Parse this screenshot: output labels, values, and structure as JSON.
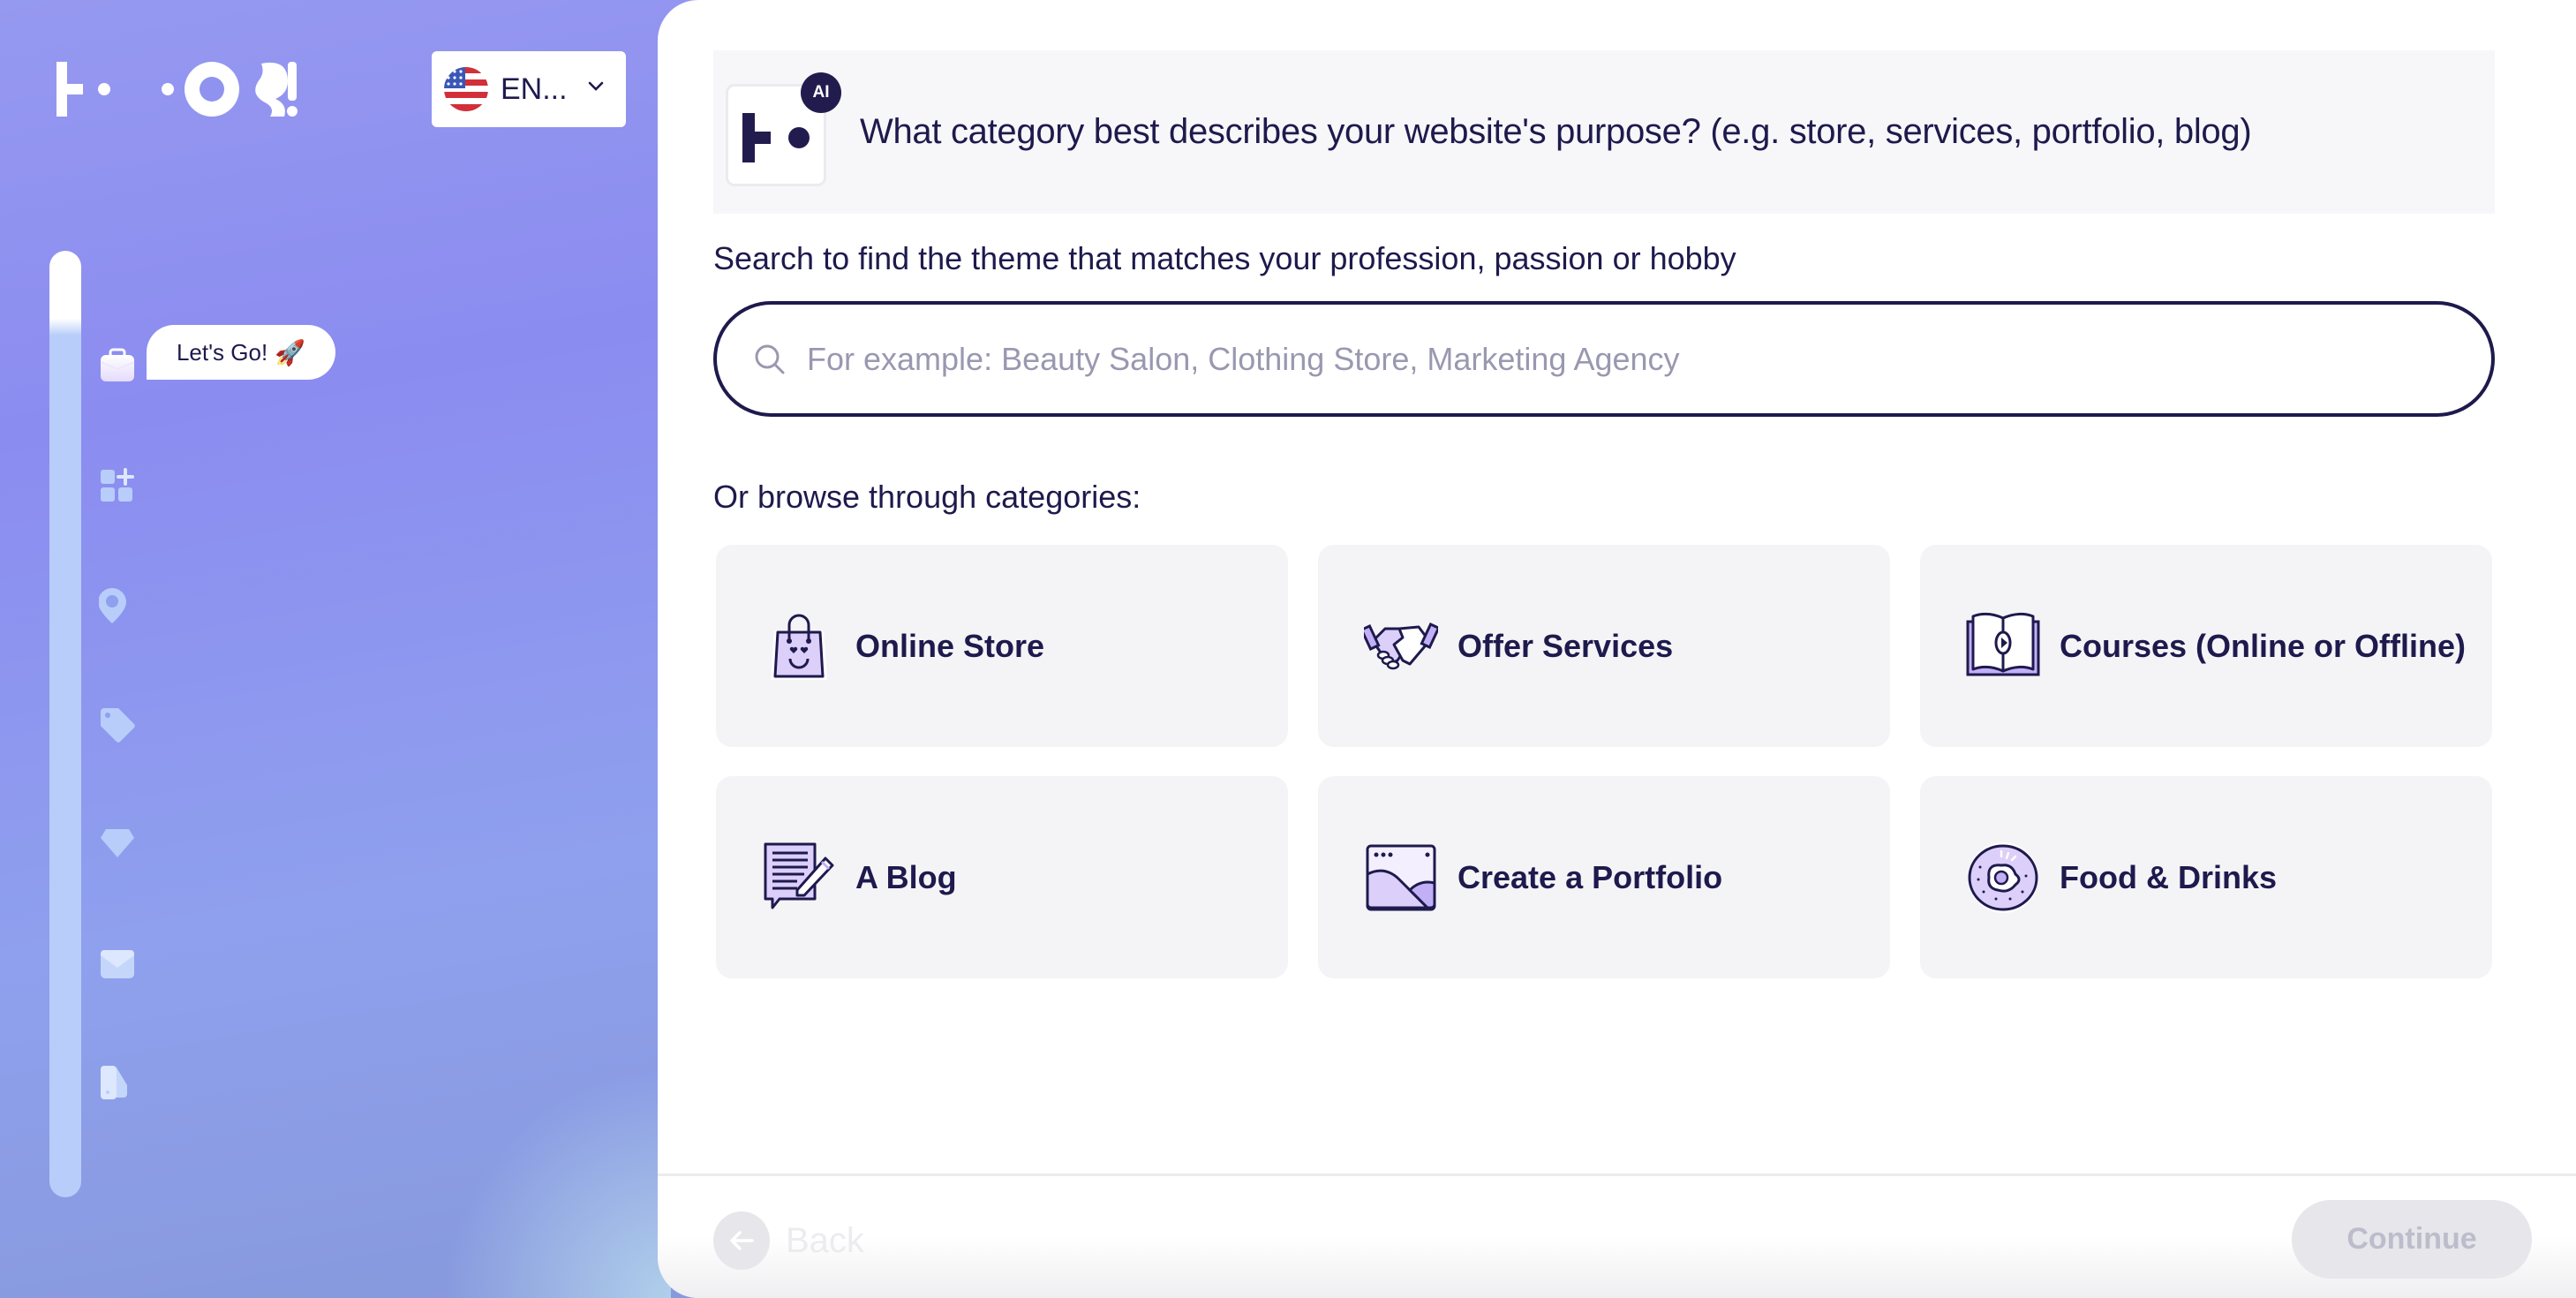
{
  "brand": {
    "logo_text": "HOCOOS!"
  },
  "language": {
    "selected": "EN...",
    "flag": "us-flag-icon"
  },
  "progress": {
    "fraction": 0.09,
    "bubble_label": "Let's Go!",
    "bubble_emoji": "🚀"
  },
  "sidebar": {
    "steps": [
      {
        "icon": "briefcase-icon",
        "active": true
      },
      {
        "icon": "add-widget-icon",
        "active": false
      },
      {
        "icon": "location-pin-icon",
        "active": false
      },
      {
        "icon": "tag-icon",
        "active": false
      },
      {
        "icon": "diamond-icon",
        "active": false
      },
      {
        "icon": "envelope-icon",
        "active": false
      },
      {
        "icon": "palette-swatch-icon",
        "active": false
      }
    ]
  },
  "question": {
    "badge": "AI",
    "text": "What category best describes your website's purpose? (e.g. store, services, portfolio, blog)"
  },
  "search": {
    "label": "Search to find the theme that matches your profession, passion or hobby",
    "placeholder": "For example: Beauty Salon, Clothing Store, Marketing Agency",
    "value": ""
  },
  "browse": {
    "label": "Or browse through categories:",
    "categories": [
      {
        "label": "Online Store",
        "icon": "shopping-bag-icon"
      },
      {
        "label": "Offer Services",
        "icon": "handshake-icon"
      },
      {
        "label": "Courses (Online or Offline)",
        "icon": "open-book-icon"
      },
      {
        "label": "A Blog",
        "icon": "blog-note-icon"
      },
      {
        "label": "Create a Portfolio",
        "icon": "portfolio-image-icon"
      },
      {
        "label": "Food & Drinks",
        "icon": "food-plate-icon"
      }
    ]
  },
  "footer": {
    "back_label": "Back",
    "continue_label": "Continue"
  },
  "colors": {
    "brand_dark": "#1e1a4d",
    "accent_light": "#dccffa",
    "accent": "#c2b0f7",
    "sidebar_bg": "#8b8cf0"
  }
}
